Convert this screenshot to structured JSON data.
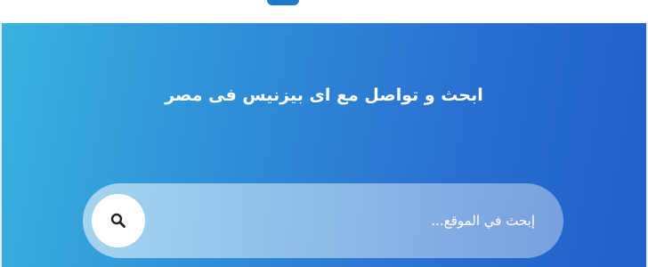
{
  "hero": {
    "title": "ابحث و تواصل مع اى بيزنيس فى مصر",
    "background_start": "#3ab2df",
    "background_end": "#1f5fc8"
  },
  "search": {
    "placeholder": "إبحث في الموقع...",
    "value": "",
    "button_icon": "search-icon"
  },
  "logo": {
    "color": "#1f78c8"
  }
}
